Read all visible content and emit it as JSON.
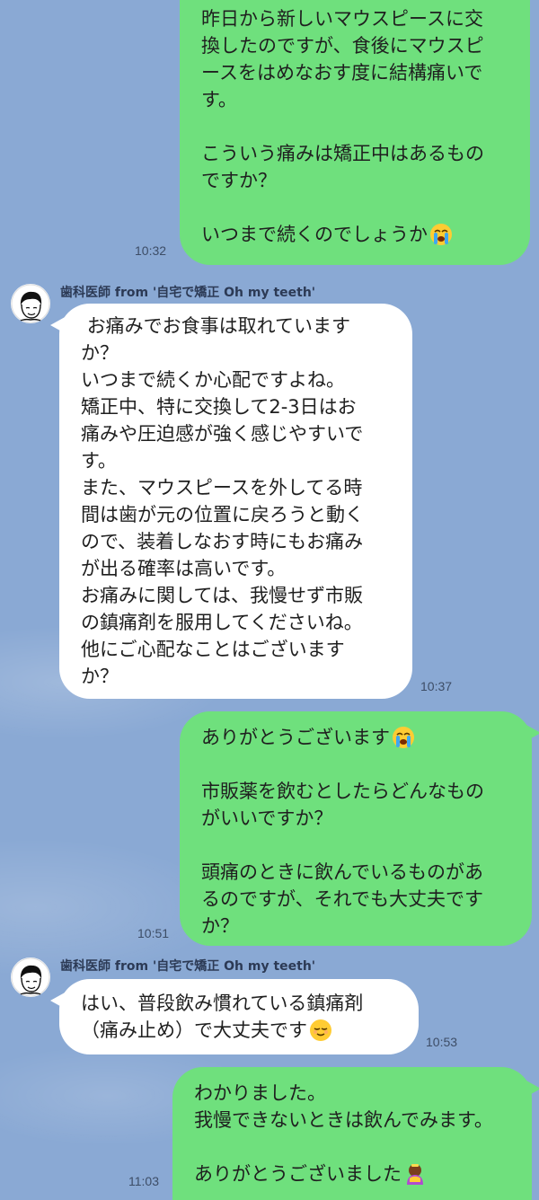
{
  "conversation": {
    "sender_name": "歯科医師 from '自宅で矯正 Oh my teeth'",
    "messages": [
      {
        "side": "out",
        "text": "昨日から新しいマウスピースに交\n換したのですが、食後にマウスピ\nースをはめなおす度に結構痛いで\nす。\n\nこういう痛みは矯正中はあるもの\nですか？\n\nいつまで続くのでしょうか",
        "emoji": "loudly-crying-face-emoji",
        "time": "10:32"
      },
      {
        "side": "in",
        "text": " お痛みでお食事は取れています\nか？\nいつまで続くか心配ですよね。\n矯正中、特に交換して2-3日はお\n痛みや圧迫感が強く感じやすいで\nす。\nまた、マウスピースを外してる時\n間は歯が元の位置に戻ろうと動く\nので、装着しなおす時にもお痛み\nが出る確率は高いです。\nお痛みに関しては、我慢せず市販\nの鎮痛剤を服用してくださいね。\n他にご心配なことはございます\nか？",
        "time": "10:37"
      },
      {
        "side": "out",
        "text": "ありがとうございます",
        "emoji": "loudly-crying-face-emoji",
        "text2": "\n\n市販薬を飲むとしたらどんなもの\nがいいですか？\n\n頭痛のときに飲んでいるものがあ\nるのですが、それでも大丈夫です\nか？",
        "time": "10:51"
      },
      {
        "side": "in",
        "text": "はい、普段飲み慣れている鎮痛剤\n（痛み止め）で大丈夫です",
        "emoji": "relieved-face-emoji",
        "time": "10:53"
      },
      {
        "side": "out",
        "text": "わかりました。\n我慢できないときは飲んでみます。\n\nありがとうございました",
        "emoji": "bowing-person-emoji",
        "time": "11:03"
      }
    ]
  },
  "colors": {
    "background": "#8aa9d4",
    "outgoing_bubble": "#6fe07d",
    "incoming_bubble": "#ffffff"
  }
}
